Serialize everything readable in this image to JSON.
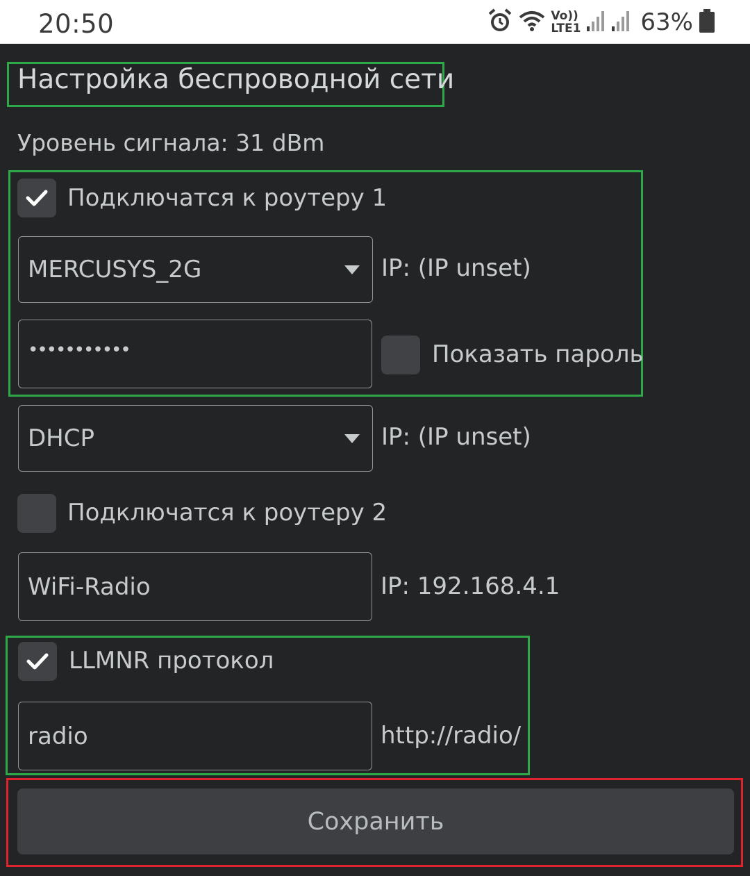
{
  "status_bar": {
    "time": "20:50",
    "battery_percent": "63%",
    "icons": [
      "alarm-icon",
      "wifi-icon",
      "volte-icon",
      "signal-icon",
      "signal-icon",
      "battery-icon"
    ],
    "volte_top": "Vo))",
    "volte_bottom": "LTE1"
  },
  "page": {
    "title": "Настройка беспроводной сети",
    "signal_level": "Уровень сигнала: 31 dBm"
  },
  "router1": {
    "enabled": true,
    "label": "Подключатся к роутеру 1",
    "ssid": "MERCUSYS_2G",
    "ip": "IP: (IP unset)",
    "password_mask": "•••••••••••",
    "show_password_label": "Показать пароль",
    "show_password_checked": false
  },
  "ip_mode": {
    "value": "DHCP",
    "ip": "IP: (IP unset)"
  },
  "router2": {
    "enabled": false,
    "label": "Подключатся к роутеру 2",
    "ap_name": "WiFi-Radio",
    "ip": "IP: 192.168.4.1"
  },
  "llmnr": {
    "enabled": true,
    "label": "LLMNR протокол",
    "hostname": "radio",
    "url": "http://radio/"
  },
  "save_button_label": "Сохранить",
  "colors": {
    "background": "#232425",
    "highlight_green": "#2fa84a",
    "highlight_red": "#e0242f"
  }
}
